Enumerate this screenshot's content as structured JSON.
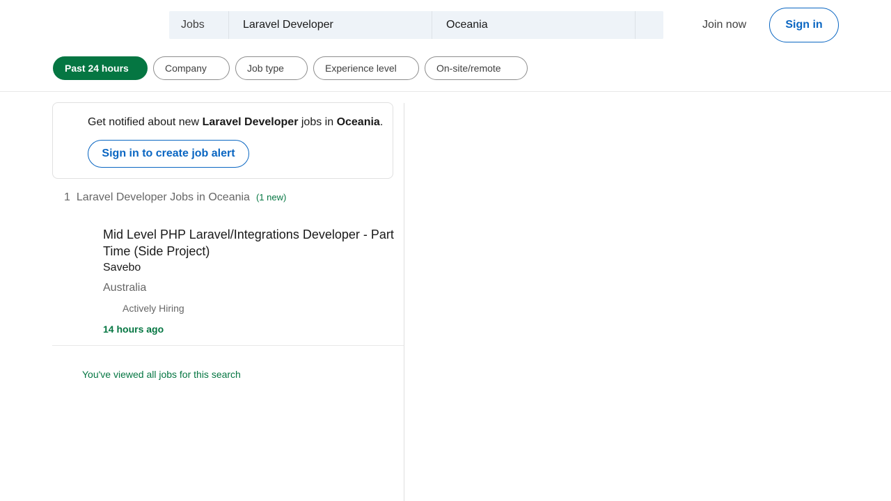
{
  "search": {
    "category": "Jobs",
    "keyword": "Laravel Developer",
    "location": "Oceania"
  },
  "header": {
    "join_label": "Join now",
    "signin_label": "Sign in"
  },
  "filters": [
    {
      "label": "Past 24 hours",
      "active": true
    },
    {
      "label": "Company",
      "active": false
    },
    {
      "label": "Job type",
      "active": false
    },
    {
      "label": "Experience level",
      "active": false
    },
    {
      "label": "On-site/remote",
      "active": false
    }
  ],
  "alert": {
    "prefix": "Get notified about new ",
    "keyword": "Laravel Developer",
    "middle": " jobs in ",
    "location": "Oceania",
    "suffix": ".",
    "button_label": "Sign in to create job alert"
  },
  "results": {
    "count": "1",
    "label": "Laravel Developer Jobs in Oceania",
    "new_badge": "(1 new)"
  },
  "jobs": [
    {
      "title": "Mid Level PHP Laravel/Integrations Developer - Part Time (Side Project)",
      "company": "Savebo",
      "location": "Australia",
      "benefit": "Actively Hiring",
      "posted": "14 hours ago"
    }
  ],
  "footer_note": "You've viewed all jobs for this search",
  "colors": {
    "brand_blue": "#0a66c2",
    "brand_green": "#057642",
    "search_bg": "#eef3f8"
  }
}
